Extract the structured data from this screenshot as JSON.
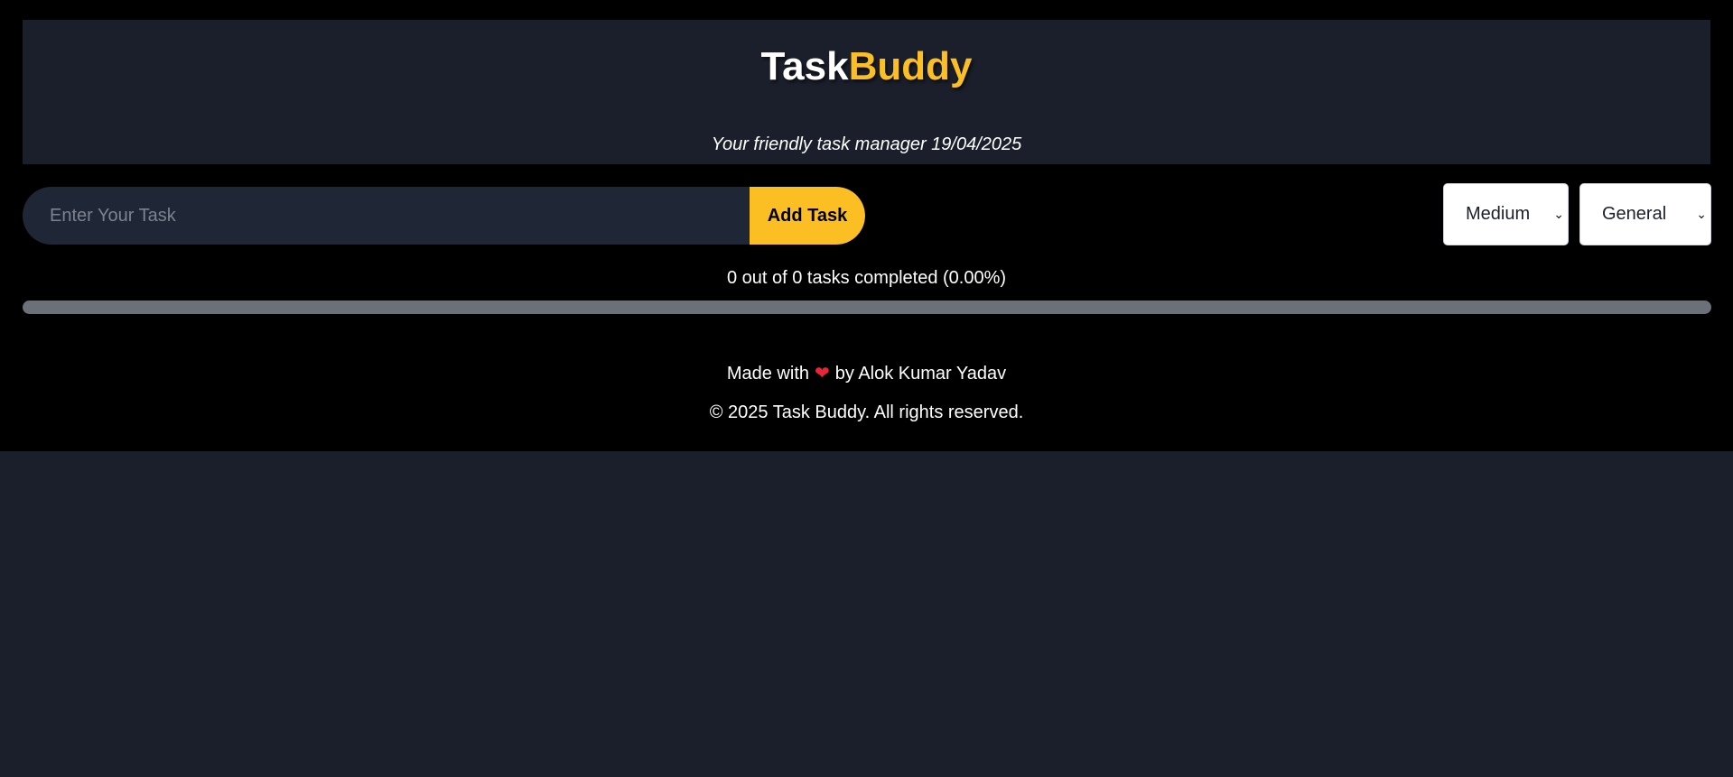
{
  "header": {
    "title_part1": "Task",
    "title_part2": "Buddy",
    "subtitle": "Your friendly task manager 19/04/2025"
  },
  "task_form": {
    "input_value": "",
    "input_placeholder": "Enter Your Task",
    "add_label": "Add Task"
  },
  "filters": {
    "priority_selected": "Medium",
    "category_selected": "General"
  },
  "progress": {
    "text": "0 out of 0 tasks completed (0.00%)",
    "completed": 0,
    "total": 0,
    "fraction": 0
  },
  "footer": {
    "made_with": "Made with",
    "heart_icon": "heart-icon",
    "by_author": "by Alok Kumar Yadav",
    "copyright": "© 2025 Task Buddy. All rights reserved."
  },
  "colors": {
    "accent": "#fbbf24",
    "background": "#000000",
    "panel": "#1b1f2b"
  }
}
